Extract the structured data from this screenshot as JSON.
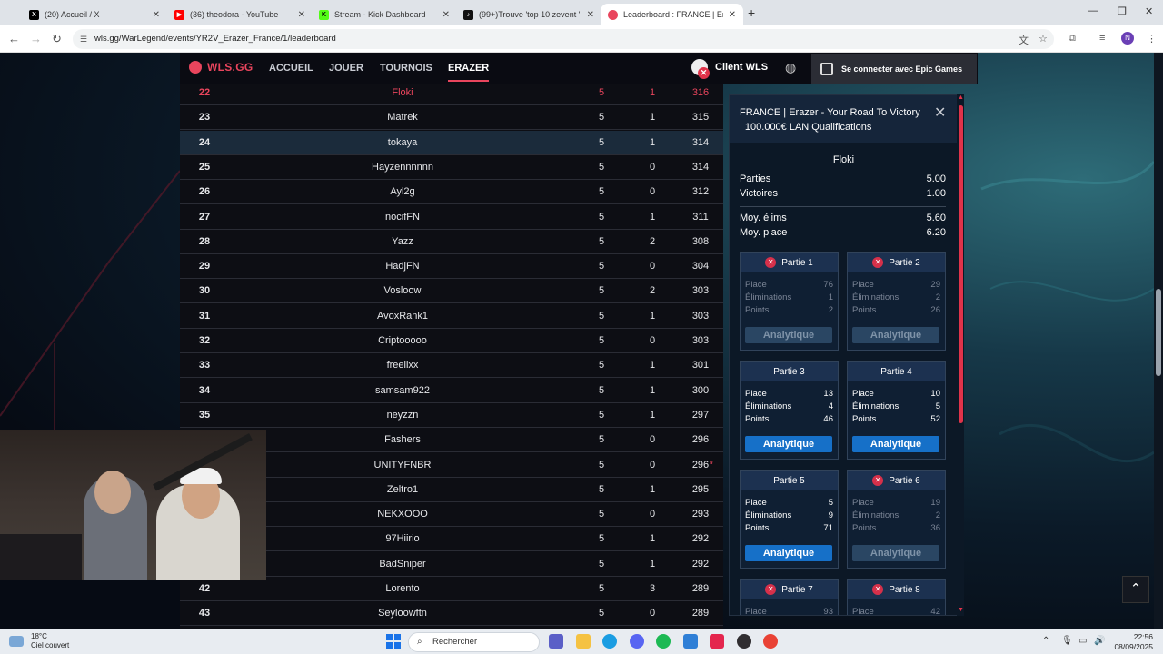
{
  "browser": {
    "tabs": [
      {
        "label": "(20) Accueil / X",
        "icon": "x-icon",
        "color": "#000000"
      },
      {
        "label": "(36) theodora - YouTube",
        "icon": "youtube-icon",
        "color": "#ff0000"
      },
      {
        "label": "Stream - Kick Dashboard",
        "icon": "kick-icon",
        "color": "#53fc18"
      },
      {
        "label": "(99+)Trouve 'top 10 zevent ' sur",
        "icon": "tiktok-icon",
        "color": "#111111"
      },
      {
        "label": "Leaderboard : FRANCE | Erazer",
        "icon": "wls-icon",
        "color": "#e9455d"
      }
    ],
    "url": "wls.gg/WarLegend/events/YR2V_Erazer_France/1/leaderboard",
    "profile_initial": "N"
  },
  "nav": {
    "brand": "WLS.GG",
    "links": [
      "ACCUEIL",
      "JOUER",
      "TOURNOIS",
      "ERAZER"
    ],
    "active": "ERAZER",
    "client": "Client WLS",
    "epic": "Se connecter avec Epic Games",
    "accent": "#e9455d"
  },
  "leaderboard": {
    "rows": [
      {
        "rank": "22",
        "name": "Floki",
        "played": "5",
        "wins": "1",
        "points": "316",
        "current": true
      },
      {
        "rank": "23",
        "name": "Matrek",
        "played": "5",
        "wins": "1",
        "points": "315"
      },
      {
        "rank": "24",
        "name": "tokaya",
        "played": "5",
        "wins": "1",
        "points": "314",
        "highlight": true
      },
      {
        "rank": "25",
        "name": "Hayzennnnnn",
        "played": "5",
        "wins": "0",
        "points": "314"
      },
      {
        "rank": "26",
        "name": "Ayl2g",
        "played": "5",
        "wins": "0",
        "points": "312"
      },
      {
        "rank": "27",
        "name": "nocifFN",
        "played": "5",
        "wins": "1",
        "points": "311"
      },
      {
        "rank": "28",
        "name": "Yazz",
        "played": "5",
        "wins": "2",
        "points": "308"
      },
      {
        "rank": "29",
        "name": "HadjFN",
        "played": "5",
        "wins": "0",
        "points": "304"
      },
      {
        "rank": "30",
        "name": "Vosloow",
        "played": "5",
        "wins": "2",
        "points": "303"
      },
      {
        "rank": "31",
        "name": "AvoxRank1",
        "played": "5",
        "wins": "1",
        "points": "303"
      },
      {
        "rank": "32",
        "name": "Criptooooo",
        "played": "5",
        "wins": "0",
        "points": "303"
      },
      {
        "rank": "33",
        "name": "freelixx",
        "played": "5",
        "wins": "1",
        "points": "301"
      },
      {
        "rank": "34",
        "name": "samsam922",
        "played": "5",
        "wins": "1",
        "points": "300"
      },
      {
        "rank": "35",
        "name": "neyzzn",
        "played": "5",
        "wins": "1",
        "points": "297"
      },
      {
        "rank": "",
        "name": "Fashers",
        "played": "5",
        "wins": "0",
        "points": "296"
      },
      {
        "rank": "",
        "name": "UNITYFNBR",
        "played": "5",
        "wins": "0",
        "points": "296",
        "mark": "*"
      },
      {
        "rank": "",
        "name": "Zeltro1",
        "played": "5",
        "wins": "1",
        "points": "295"
      },
      {
        "rank": "",
        "name": "NEKXOOO",
        "played": "5",
        "wins": "0",
        "points": "293"
      },
      {
        "rank": "",
        "name": "97Hiirio",
        "played": "5",
        "wins": "1",
        "points": "292"
      },
      {
        "rank": "",
        "name": "BadSniper",
        "played": "5",
        "wins": "1",
        "points": "292"
      },
      {
        "rank": "42",
        "name": "Lorento",
        "played": "5",
        "wins": "3",
        "points": "289"
      },
      {
        "rank": "43",
        "name": "Seyloowftn",
        "played": "5",
        "wins": "0",
        "points": "289"
      }
    ]
  },
  "panel": {
    "title": "FRANCE | Erazer - Your Road To Victory | 100.000€ LAN Qualifications",
    "player": "Floki",
    "stats": [
      {
        "label": "Parties",
        "value": "5.00"
      },
      {
        "label": "Victoires",
        "value": "1.00"
      },
      {
        "label": "Moy. élims",
        "value": "5.60"
      },
      {
        "label": "Moy. place",
        "value": "6.20"
      }
    ],
    "labels": {
      "place": "Place",
      "elims": "Éliminations",
      "points": "Points",
      "button": "Analytique"
    },
    "games": [
      {
        "title": "Partie 1",
        "place": "76",
        "elims": "1",
        "points": "2",
        "counted": false
      },
      {
        "title": "Partie 2",
        "place": "29",
        "elims": "2",
        "points": "26",
        "counted": false
      },
      {
        "title": "Partie 3",
        "place": "13",
        "elims": "4",
        "points": "46",
        "counted": true
      },
      {
        "title": "Partie 4",
        "place": "10",
        "elims": "5",
        "points": "52",
        "counted": true
      },
      {
        "title": "Partie 5",
        "place": "5",
        "elims": "9",
        "points": "71",
        "counted": true
      },
      {
        "title": "Partie 6",
        "place": "19",
        "elims": "2",
        "points": "36",
        "counted": false
      },
      {
        "title": "Partie 7",
        "place": "93",
        "elims": "",
        "points": "",
        "counted": false
      },
      {
        "title": "Partie 8",
        "place": "42",
        "elims": "",
        "points": "",
        "counted": false
      }
    ]
  },
  "taskbar": {
    "weather_temp": "18°C",
    "weather_desc": "Ciel couvert",
    "search_placeholder": "Rechercher",
    "time": "22:56",
    "date": "08/09/2025"
  }
}
